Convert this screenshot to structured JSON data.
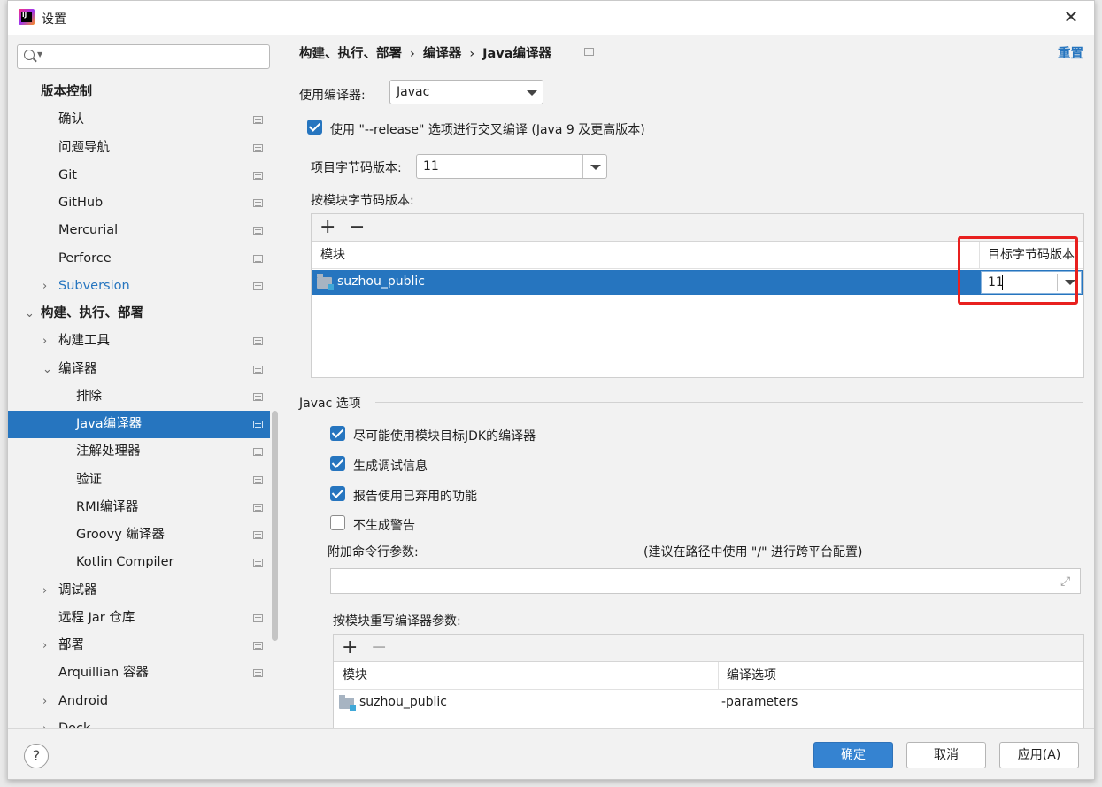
{
  "window": {
    "title": "设置",
    "close_icon": "close-icon"
  },
  "sidebar": {
    "search": {
      "placeholder": ""
    },
    "items": [
      {
        "label": "版本控制"
      },
      {
        "label": "确认"
      },
      {
        "label": "问题导航"
      },
      {
        "label": "Git"
      },
      {
        "label": "GitHub"
      },
      {
        "label": "Mercurial"
      },
      {
        "label": "Perforce"
      },
      {
        "label": "Subversion"
      },
      {
        "label": "构建、执行、部署"
      },
      {
        "label": "构建工具"
      },
      {
        "label": "编译器"
      },
      {
        "label": "排除"
      },
      {
        "label": "Java编译器"
      },
      {
        "label": "注解处理器"
      },
      {
        "label": "验证"
      },
      {
        "label": "RMI编译器"
      },
      {
        "label": "Groovy 编译器"
      },
      {
        "label": "Kotlin Compiler"
      },
      {
        "label": "调试器"
      },
      {
        "label": "远程 Jar 仓库"
      },
      {
        "label": "部署"
      },
      {
        "label": "Arquillian 容器"
      },
      {
        "label": "Android"
      },
      {
        "label": "Dock"
      }
    ]
  },
  "breadcrumb": {
    "part1": "构建、执行、部署",
    "part2": "编译器",
    "part3": "Java编译器",
    "sep": "›"
  },
  "reset_label": "重置",
  "compiler": {
    "label": "使用编译器:",
    "value": "Javac"
  },
  "release_option": {
    "checked": true,
    "label": "使用 \"--release\" 选项进行交叉编译 (Java 9 及更高版本)"
  },
  "bytecode": {
    "label": "项目字节码版本:",
    "value": "11"
  },
  "per_module": {
    "label": "按模块字节码版本:",
    "add": "+",
    "remove": "−",
    "columns": {
      "module": "模块",
      "target": "目标字节码版本"
    },
    "rows": [
      {
        "module": "suzhou_public",
        "target": "11"
      }
    ]
  },
  "javac": {
    "section_title": "Javac 选项",
    "options": [
      {
        "label": "尽可能使用模块目标JDK的编译器",
        "checked": true
      },
      {
        "label": "生成调试信息",
        "checked": true
      },
      {
        "label": "报告使用已弃用的功能",
        "checked": true
      },
      {
        "label": "不生成警告",
        "checked": false
      }
    ],
    "cmd_label": "附加命令行参数:",
    "cmd_hint": "(建议在路径中使用 \"/\" 进行跨平台配置)",
    "cmd_value": ""
  },
  "override": {
    "label": "按模块重写编译器参数:",
    "add": "+",
    "remove": "−",
    "columns": {
      "module": "模块",
      "options": "编译选项"
    },
    "rows": [
      {
        "module": "suzhou_public",
        "options": "-parameters"
      }
    ]
  },
  "footer": {
    "help": "?",
    "ok": "确定",
    "cancel": "取消",
    "apply": "应用(A)"
  },
  "colors": {
    "accent": "#2675bf",
    "highlight": "#e8201f"
  }
}
